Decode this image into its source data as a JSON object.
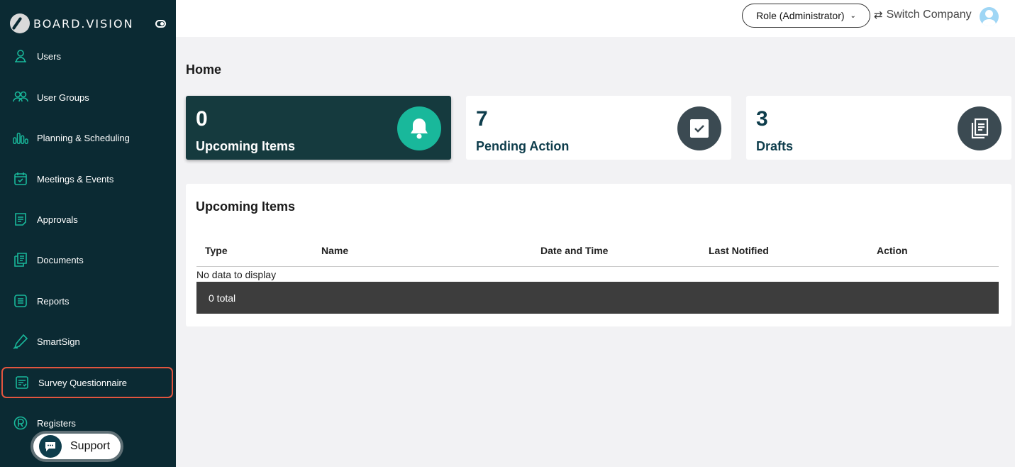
{
  "brand": {
    "name": "BOARD.VISION"
  },
  "sidebar": {
    "items": [
      {
        "label": "Users",
        "icon": "user-icon"
      },
      {
        "label": "User Groups",
        "icon": "users-icon"
      },
      {
        "label": "Planning & Scheduling",
        "icon": "chart-bars-icon"
      },
      {
        "label": "Meetings & Events",
        "icon": "calendar-check-icon"
      },
      {
        "label": "Approvals",
        "icon": "document-icon"
      },
      {
        "label": "Documents",
        "icon": "documents-icon"
      },
      {
        "label": "Reports",
        "icon": "report-list-icon"
      },
      {
        "label": "SmartSign",
        "icon": "pen-icon"
      },
      {
        "label": "Survey Questionnaire",
        "icon": "survey-icon",
        "active": true
      },
      {
        "label": "Registers",
        "icon": "registered-icon"
      }
    ],
    "support_label": "Support"
  },
  "header": {
    "role": "Role (Administrator)",
    "switch_company": "Switch Company"
  },
  "page": {
    "title": "Home"
  },
  "cards": [
    {
      "count": "0",
      "label": "Upcoming Items",
      "icon": "bell-icon"
    },
    {
      "count": "7",
      "label": "Pending Action",
      "icon": "checkbox-icon"
    },
    {
      "count": "3",
      "label": "Drafts",
      "icon": "drafts-icon"
    }
  ],
  "upcoming": {
    "title": "Upcoming Items",
    "columns": [
      "Type",
      "Name",
      "Date and Time",
      "Last Notified",
      "Action"
    ],
    "empty_text": "No data to display",
    "total_text": "0 total"
  },
  "colors": {
    "sidebar_bg": "#0b2a33",
    "accent": "#19b89b",
    "active_outline": "#e2553f",
    "primary_text": "#0e3d4c"
  }
}
